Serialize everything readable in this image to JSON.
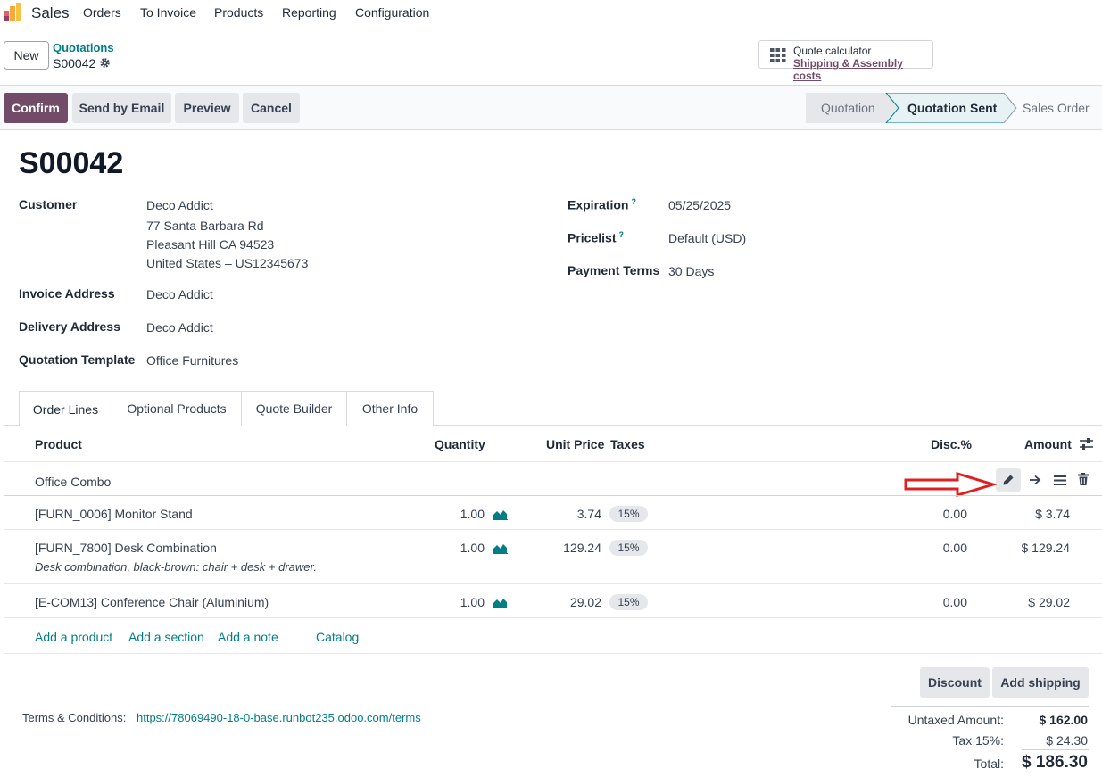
{
  "nav": {
    "app_name": "Sales",
    "menu": [
      "Orders",
      "To Invoice",
      "Products",
      "Reporting",
      "Configuration"
    ]
  },
  "control": {
    "new_label": "New",
    "breadcrumb_parent": "Quotations",
    "breadcrumb_current": "S00042",
    "quote_calc_title": "Quote calculator",
    "quote_calc_sub": "Shipping & Assembly costs"
  },
  "status": {
    "confirm": "Confirm",
    "send_email": "Send by Email",
    "preview": "Preview",
    "cancel": "Cancel",
    "steps": [
      "Quotation",
      "Quotation Sent",
      "Sales Order"
    ],
    "active_step": "Quotation Sent"
  },
  "form": {
    "title": "S00042",
    "customer_label": "Customer",
    "customer_name": "Deco Addict",
    "customer_addr1": "77 Santa Barbara Rd",
    "customer_addr2": "Pleasant Hill CA 94523",
    "customer_addr3": "United States – US12345673",
    "invoice_label": "Invoice Address",
    "invoice_value": "Deco Addict",
    "delivery_label": "Delivery Address",
    "delivery_value": "Deco Addict",
    "template_label": "Quotation Template",
    "template_value": "Office Furnitures",
    "expiration_label": "Expiration",
    "expiration_value": "05/25/2025",
    "pricelist_label": "Pricelist",
    "pricelist_value": "Default (USD)",
    "payment_label": "Payment Terms",
    "payment_value": "30 Days",
    "help_mark": "?"
  },
  "tabs": [
    "Order Lines",
    "Optional Products",
    "Quote Builder",
    "Other Info"
  ],
  "table": {
    "headers": {
      "product": "Product",
      "quantity": "Quantity",
      "unit_price": "Unit Price",
      "taxes": "Taxes",
      "disc": "Disc.%",
      "amount": "Amount"
    },
    "section": "Office Combo",
    "rows": [
      {
        "product": "[FURN_0006] Monitor Stand",
        "qty": "1.00",
        "price": "3.74",
        "tax": "15%",
        "disc": "0.00",
        "amount": "$ 3.74",
        "desc": ""
      },
      {
        "product": "[FURN_7800] Desk Combination",
        "qty": "1.00",
        "price": "129.24",
        "tax": "15%",
        "disc": "0.00",
        "amount": "$ 129.24",
        "desc": "Desk combination, black-brown: chair + desk + drawer."
      },
      {
        "product": "[E-COM13] Conference Chair (Aluminium)",
        "qty": "1.00",
        "price": "29.02",
        "tax": "15%",
        "disc": "0.00",
        "amount": "$ 29.02",
        "desc": ""
      }
    ],
    "add_product": "Add a product",
    "add_section": "Add a section",
    "add_note": "Add a note",
    "catalog": "Catalog"
  },
  "footer": {
    "discount": "Discount",
    "add_shipping": "Add shipping",
    "terms_label": "Terms & Conditions:",
    "terms_link": "https://78069490-18-0-base.runbot235.odoo.com/terms",
    "untaxed_label": "Untaxed Amount:",
    "untaxed_value": "$ 162.00",
    "tax_label": "Tax 15%:",
    "tax_value": "$ 24.30",
    "total_label": "Total:",
    "total_value": "$ 186.30"
  },
  "colors": {
    "brand": "#714b67",
    "link": "#017e84",
    "arrow": "#e02020"
  }
}
